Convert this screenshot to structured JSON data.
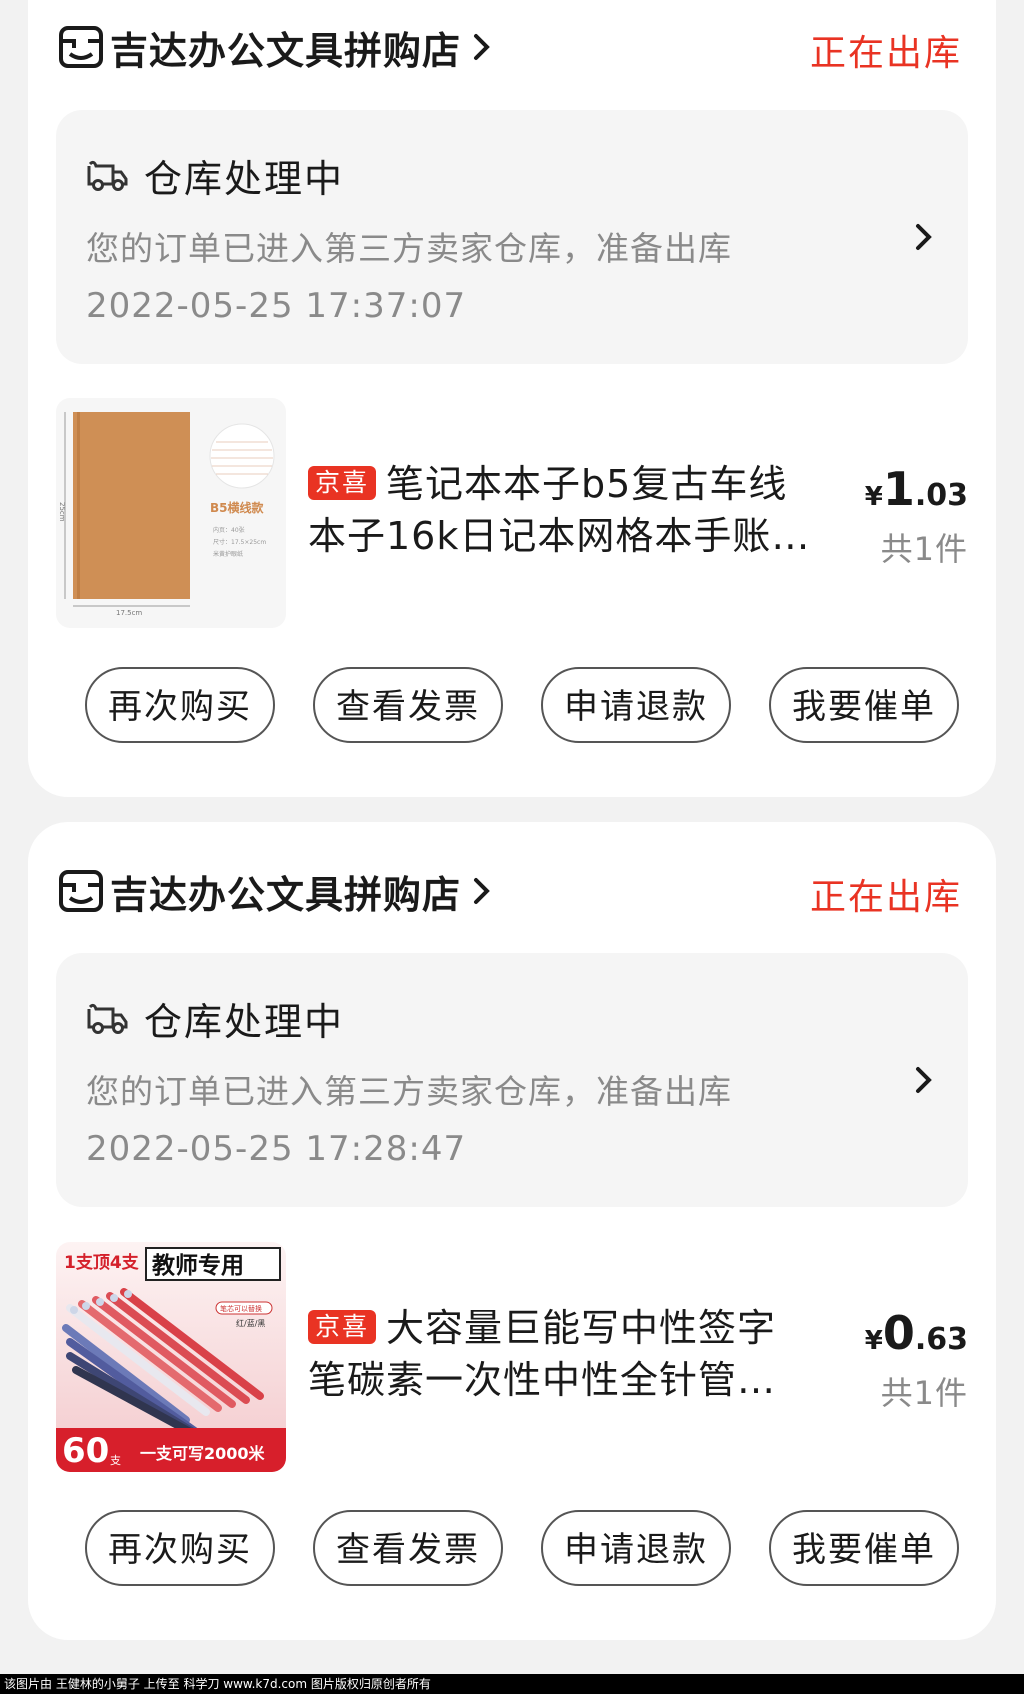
{
  "orders": [
    {
      "shop_name": "吉达办公文具拼购店",
      "status": "正在出库",
      "tracking": {
        "title": "仓库处理中",
        "description": "您的订单已进入第三方卖家仓库，准备出库",
        "time": "2022-05-25 17:37:07"
      },
      "product": {
        "badge": "京喜",
        "title": "笔记本本子b5复古车线本子16k日记本网格本手账…",
        "title_line1": "笔记本本子b5复古车线",
        "title_line2": "本子16k日记本网格本手账…",
        "price_symbol": "¥",
        "price_int": "1",
        "price_dec": ".03",
        "quantity": "共1件",
        "image_text": {
          "label": "B5横线款",
          "spec1": "内页：40张",
          "spec2": "尺寸：17.5×25cm",
          "spec3": "米黄护眼纸",
          "width": "17.5cm",
          "height": "25cm"
        }
      },
      "buttons": [
        "再次购买",
        "查看发票",
        "申请退款",
        "我要催单"
      ]
    },
    {
      "shop_name": "吉达办公文具拼购店",
      "status": "正在出库",
      "tracking": {
        "title": "仓库处理中",
        "description": "您的订单已进入第三方卖家仓库，准备出库",
        "time": "2022-05-25 17:28:47"
      },
      "product": {
        "badge": "京喜",
        "title": "大容量巨能写中性签字笔碳素一次性中性全针管…",
        "title_line1": "大容量巨能写中性签字",
        "title_line2": "笔碳素一次性中性全针管…",
        "price_symbol": "¥",
        "price_int": "0",
        "price_dec": ".63",
        "quantity": "共1件",
        "image_text": {
          "top_left": "1支顶4支",
          "top_right": "教师专用",
          "tag": "笔芯可以替换",
          "colors": "红/蓝/黑",
          "count": "60",
          "count_unit": "支",
          "slogan": "一支可写2000米"
        }
      },
      "buttons": [
        "再次购买",
        "查看发票",
        "申请退款",
        "我要催单"
      ]
    }
  ],
  "footer": "该图片由 王健林的小舅子 上传至 科学刀 www.k7d.com 图片版权归原创者所有",
  "colors": {
    "accent": "#e93323",
    "muted": "#8a8a8a",
    "background": "#f2f2f2"
  }
}
